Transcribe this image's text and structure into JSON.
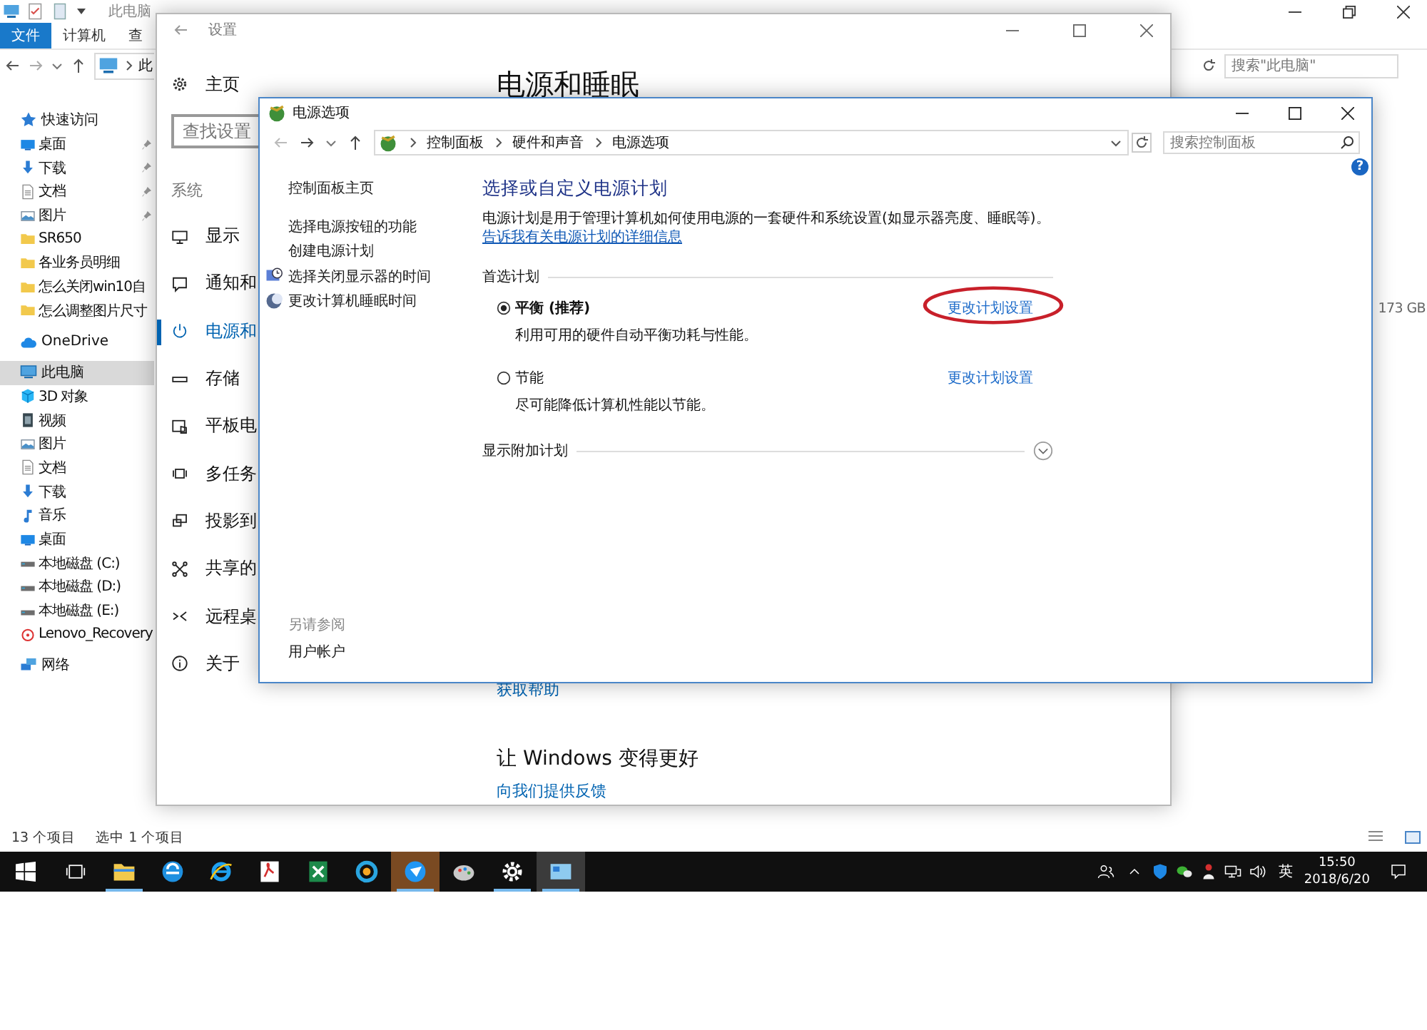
{
  "explorer": {
    "title": "此电脑",
    "ribbon_tabs": [
      {
        "label": "文件",
        "selected": true
      },
      {
        "label": "计算机",
        "selected": false
      },
      {
        "label": "查",
        "selected": false
      }
    ],
    "address": "此",
    "search": {
      "placeholder": "搜索\"此电脑\""
    },
    "nav": [
      {
        "label": "快速访问",
        "kind": "star",
        "selected": false,
        "children": [
          {
            "label": "桌面",
            "kind": "desktop",
            "pinned": true,
            "selected": false
          },
          {
            "label": "下载",
            "kind": "download",
            "pinned": true,
            "selected": false
          },
          {
            "label": "文档",
            "kind": "document",
            "pinned": true,
            "selected": false
          },
          {
            "label": "图片",
            "kind": "picture",
            "pinned": true,
            "selected": false
          },
          {
            "label": "SR650",
            "kind": "folder",
            "pinned": false,
            "selected": false
          },
          {
            "label": "各业务员明细",
            "kind": "folder",
            "pinned": false,
            "selected": false
          },
          {
            "label": "怎么关闭win10自",
            "kind": "folder",
            "pinned": false,
            "selected": false
          },
          {
            "label": "怎么调整图片尺寸",
            "kind": "folder",
            "pinned": false,
            "selected": false
          }
        ]
      },
      {
        "label": "OneDrive",
        "kind": "cloud",
        "selected": false
      },
      {
        "label": "此电脑",
        "kind": "pc",
        "selected": true,
        "children": [
          {
            "label": "3D 对象",
            "kind": "cube",
            "pinned": false,
            "selected": false
          },
          {
            "label": "视频",
            "kind": "video",
            "pinned": false,
            "selected": false
          },
          {
            "label": "图片",
            "kind": "picture",
            "pinned": false,
            "selected": false
          },
          {
            "label": "文档",
            "kind": "document",
            "pinned": false,
            "selected": false
          },
          {
            "label": "下载",
            "kind": "download",
            "pinned": false,
            "selected": false
          },
          {
            "label": "音乐",
            "kind": "music",
            "pinned": false,
            "selected": false
          },
          {
            "label": "桌面",
            "kind": "desktop",
            "pinned": false,
            "selected": false
          },
          {
            "label": "本地磁盘 (C:)",
            "kind": "drive",
            "pinned": false,
            "selected": false
          },
          {
            "label": "本地磁盘 (D:)",
            "kind": "drive",
            "pinned": false,
            "selected": false
          },
          {
            "label": "本地磁盘 (E:)",
            "kind": "drive",
            "pinned": false,
            "selected": false
          },
          {
            "label": "Lenovo_Recovery",
            "kind": "recovery",
            "pinned": false,
            "selected": false
          }
        ]
      },
      {
        "label": "网络",
        "kind": "network",
        "selected": false
      }
    ],
    "drive_size": "173 GB",
    "status": {
      "count": "13 个项目",
      "selection": "选中 1 个项目"
    }
  },
  "settings": {
    "title": "设置",
    "home": "主页",
    "search": {
      "placeholder": "查找设置"
    },
    "section": "系统",
    "items": [
      {
        "label": "显示",
        "kind": "display",
        "selected": false
      },
      {
        "label": "通知和",
        "kind": "notify",
        "selected": false
      },
      {
        "label": "电源和",
        "kind": "power",
        "selected": true
      },
      {
        "label": "存储",
        "kind": "storage",
        "selected": false
      },
      {
        "label": "平板电",
        "kind": "tablet",
        "selected": false
      },
      {
        "label": "多任务",
        "kind": "multitask",
        "selected": false
      },
      {
        "label": "投影到",
        "kind": "project",
        "selected": false
      },
      {
        "label": "共享的",
        "kind": "share",
        "selected": false
      },
      {
        "label": "远程桌",
        "kind": "remote",
        "selected": false
      },
      {
        "label": "关于",
        "kind": "about",
        "selected": false
      }
    ],
    "heading": "电源和睡眠",
    "help_link": "获取帮助",
    "improve_heading": "让 Windows 变得更好",
    "feedback_link": "向我们提供反馈"
  },
  "power": {
    "title": "电源选项",
    "breadcrumb": [
      "控制面板",
      "硬件和声音",
      "电源选项"
    ],
    "search": {
      "placeholder": "搜索控制面板"
    },
    "help": "?",
    "sidebar": {
      "home": "控制面板主页",
      "links": [
        {
          "label": "选择电源按钮的功能",
          "kind": "plain"
        },
        {
          "label": "创建电源计划",
          "kind": "plain"
        },
        {
          "label": "选择关闭显示器的时间",
          "kind": "monitor"
        },
        {
          "label": "更改计算机睡眠时间",
          "kind": "moon"
        }
      ],
      "see_also_label": "另请参阅",
      "see_also": [
        "用户帐户"
      ]
    },
    "heading": "选择或自定义电源计划",
    "description": "电源计划是用于管理计算机如何使用电源的一套硬件和系统设置(如显示器亮度、睡眠等)。",
    "description_link": "告诉我有关电源计划的详细信息",
    "plans_label": "首选计划",
    "plans": [
      {
        "name": "平衡 (推荐)",
        "description": "利用可用的硬件自动平衡功耗与性能。",
        "link": "更改计划设置",
        "selected": true,
        "highlighted": true
      },
      {
        "name": "节能",
        "description": "尽可能降低计算机性能以节能。",
        "link": "更改计划设置",
        "selected": false,
        "highlighted": false
      }
    ],
    "more_plans": {
      "label": "显示附加计划",
      "expanded": false
    }
  },
  "taskbar": {
    "apps": [
      {
        "kind": "folder",
        "running": true,
        "selected": false,
        "attention": false
      },
      {
        "kind": "edge",
        "running": false,
        "selected": false,
        "attention": false
      },
      {
        "kind": "ie",
        "running": false,
        "selected": false,
        "attention": false
      },
      {
        "kind": "pdf",
        "running": false,
        "selected": false,
        "attention": false
      },
      {
        "kind": "sheet",
        "running": false,
        "selected": false,
        "attention": false
      },
      {
        "kind": "ring",
        "running": false,
        "selected": false,
        "attention": false
      },
      {
        "kind": "bird",
        "running": true,
        "selected": false,
        "attention": true
      },
      {
        "kind": "palette",
        "running": false,
        "selected": false,
        "attention": false
      },
      {
        "kind": "gear",
        "running": true,
        "selected": false,
        "attention": false
      },
      {
        "kind": "panel",
        "running": true,
        "selected": true,
        "attention": false
      }
    ],
    "ime": "英",
    "time": "15:50",
    "date": "2018/6/20"
  }
}
